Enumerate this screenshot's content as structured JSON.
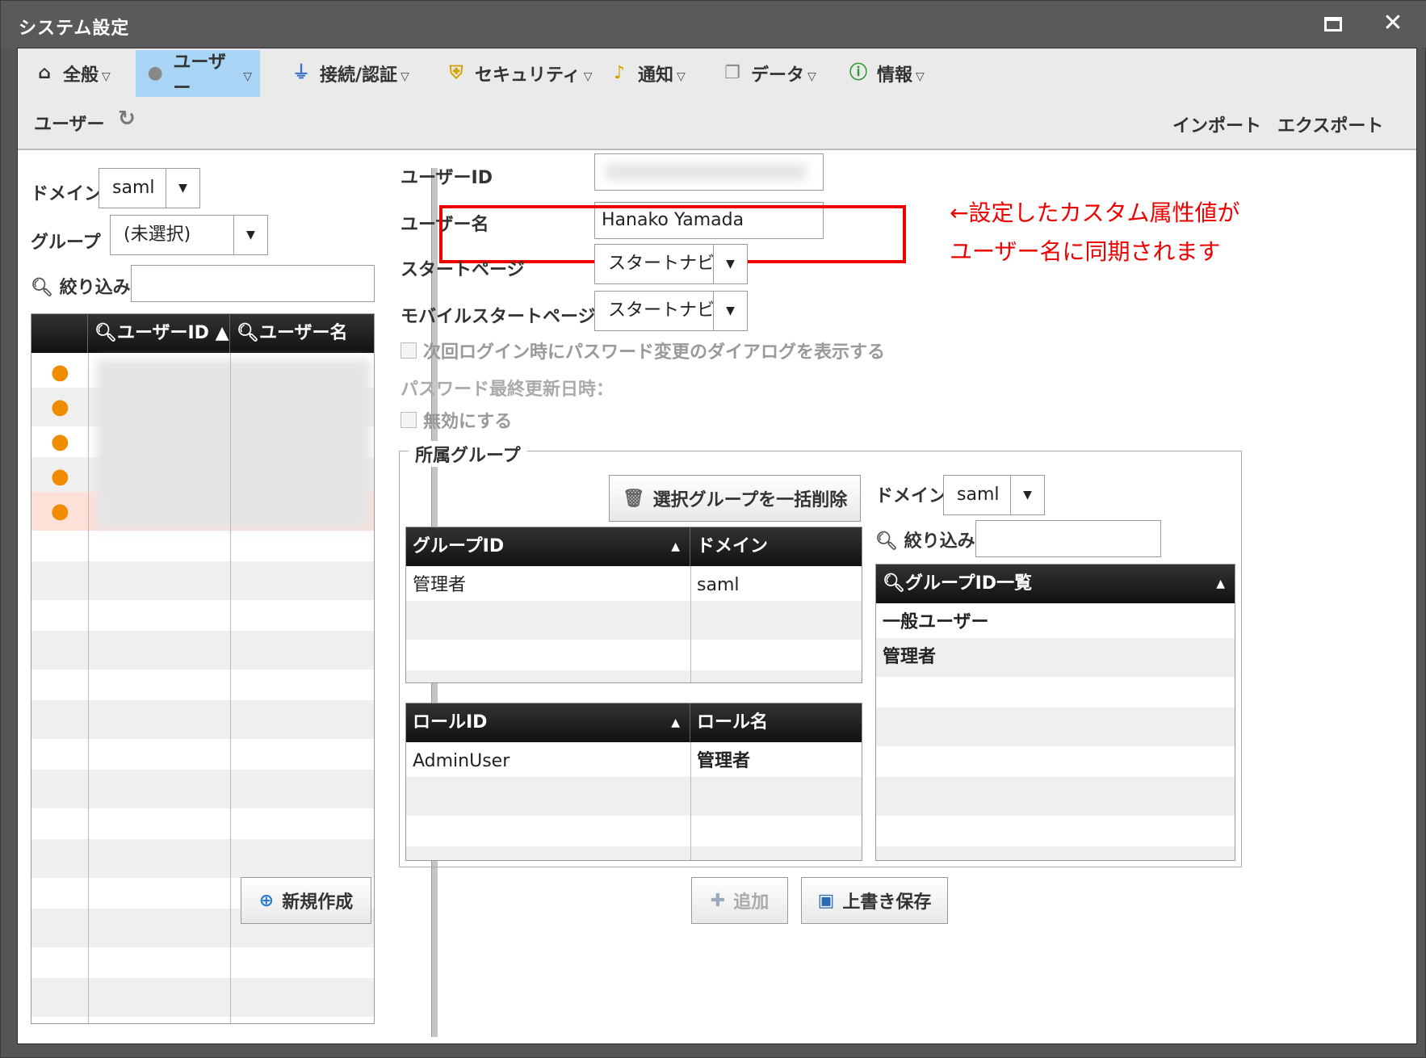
{
  "window": {
    "title": "システム設定",
    "maximize_label": "",
    "close_label": "✕"
  },
  "menu": {
    "items": [
      {
        "label": "全般",
        "icon": "home-icon"
      },
      {
        "label": "ユーザー",
        "icon": "user-icon"
      },
      {
        "label": "接続/認証",
        "icon": "plug-icon"
      },
      {
        "label": "セキュリティ",
        "icon": "shield-icon"
      },
      {
        "label": "通知",
        "icon": "bell-icon"
      },
      {
        "label": "データ",
        "icon": "copy-icon"
      },
      {
        "label": "情報",
        "icon": "info-icon"
      }
    ],
    "dropdown_glyph": "▽"
  },
  "subheader": {
    "title": "ユーザー",
    "refresh_icon": "refresh-icon",
    "import_label": "インポート",
    "export_label": "エクスポート"
  },
  "left": {
    "domain_label": "ドメイン",
    "domain_value": "saml",
    "group_label": "グループ",
    "group_value": "(未選択)",
    "filter_label": "絞り込み",
    "filter_value": "",
    "columns": [
      "ユーザーID ▲",
      "ユーザー名"
    ],
    "new_button": "新規作成"
  },
  "form": {
    "userid_label": "ユーザーID",
    "username_label": "ユーザー名",
    "username_value": "Hanako Yamada",
    "startpage_label": "スタートページ",
    "startpage_value": "スタートナビ",
    "mobile_startpage_label": "モバイルスタートページ",
    "mobile_startpage_value": "スタートナビ",
    "next_login_change_pw": "次回ログイン時にパスワード変更のダイアログを表示する",
    "password_last_updated": "パスワード最終更新日時：",
    "disable_label": "無効にする"
  },
  "annotation": {
    "line1": "←設定したカスタム属性値が",
    "line2": "ユーザー名に同期されます",
    "color": "#e00000"
  },
  "groups": {
    "legend": "所属グループ",
    "bulk_delete_button": "選択グループを一括削除",
    "group_table": {
      "columns": [
        "グループID",
        "ドメイン"
      ],
      "sort_glyph": "▲",
      "rows": [
        [
          "管理者",
          "saml"
        ]
      ]
    },
    "role_table": {
      "columns": [
        "ロールID",
        "ロール名"
      ],
      "sort_glyph": "▲",
      "rows": [
        [
          "AdminUser",
          "管理者"
        ]
      ]
    },
    "right_domain_label": "ドメイン",
    "right_domain_value": "saml",
    "right_filter_label": "絞り込み",
    "right_filter_value": "",
    "group_list": {
      "column": "グループID一覧",
      "sort_glyph": "▲",
      "rows": [
        "一般ユーザー",
        "管理者"
      ]
    }
  },
  "footer": {
    "add_button": "追加",
    "save_button": "上書き保存"
  }
}
